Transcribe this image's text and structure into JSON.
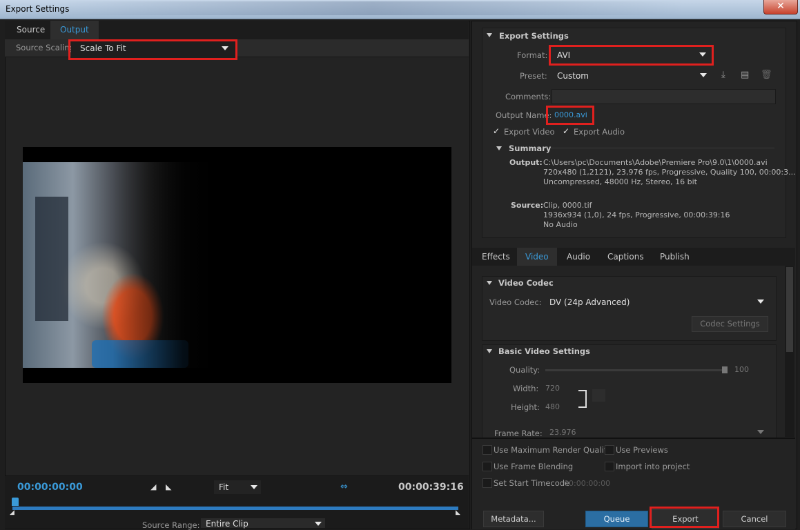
{
  "window": {
    "title": "Export Settings",
    "close_glyph": "✕"
  },
  "left": {
    "tabs": [
      {
        "label": "Source"
      },
      {
        "label": "Output"
      }
    ],
    "source_scaling": {
      "label": "Source Scaling:",
      "value": "Scale To Fit"
    },
    "timecode_in": "00:00:00:00",
    "timecode_out": "00:00:39:16",
    "fit": {
      "value": "Fit"
    },
    "source_range": {
      "label": "Source Range:",
      "value": "Entire Clip"
    }
  },
  "export_settings": {
    "header": "Export Settings",
    "format": {
      "label": "Format:",
      "value": "AVI"
    },
    "preset": {
      "label": "Preset:",
      "value": "Custom"
    },
    "comments": {
      "label": "Comments:",
      "value": ""
    },
    "output_name": {
      "label": "Output Name:",
      "value": "0000.avi"
    },
    "export_video": {
      "label": "Export Video",
      "checked": true
    },
    "export_audio": {
      "label": "Export Audio",
      "checked": true
    },
    "summary": {
      "header": "Summary",
      "output_label": "Output:",
      "output_lines": [
        "C:\\Users\\pc\\Documents\\Adobe\\Premiere Pro\\9.0\\1\\0000.avi",
        "720x480 (1,2121), 23,976 fps, Progressive, Quality 100, 00:00:3...",
        "Uncompressed, 48000 Hz, Stereo, 16 bit"
      ],
      "source_label": "Source:",
      "source_lines": [
        "Clip, 0000.tif",
        "1936x934 (1,0), 24 fps, Progressive, 00:00:39:16",
        "No Audio"
      ]
    }
  },
  "sub_tabs": [
    {
      "label": "Effects"
    },
    {
      "label": "Video"
    },
    {
      "label": "Audio"
    },
    {
      "label": "Captions"
    },
    {
      "label": "Publish"
    }
  ],
  "video_codec": {
    "header": "Video Codec",
    "label": "Video Codec:",
    "value": "DV (24p Advanced)",
    "codec_settings": "Codec Settings"
  },
  "basic_video": {
    "header": "Basic Video Settings",
    "quality": {
      "label": "Quality:",
      "value": "100"
    },
    "width": {
      "label": "Width:",
      "value": "720"
    },
    "height": {
      "label": "Height:",
      "value": "480"
    },
    "frame_rate": {
      "label": "Frame Rate:",
      "value": "23.976"
    }
  },
  "options": {
    "max_render": "Use Maximum Render Quality",
    "use_previews": "Use Previews",
    "frame_blending": "Use Frame Blending",
    "import_project": "Import into project",
    "start_timecode": "Set Start Timecode",
    "start_timecode_value": "00:00:00:00"
  },
  "buttons": {
    "metadata": "Metadata...",
    "queue": "Queue",
    "export": "Export",
    "cancel": "Cancel"
  }
}
